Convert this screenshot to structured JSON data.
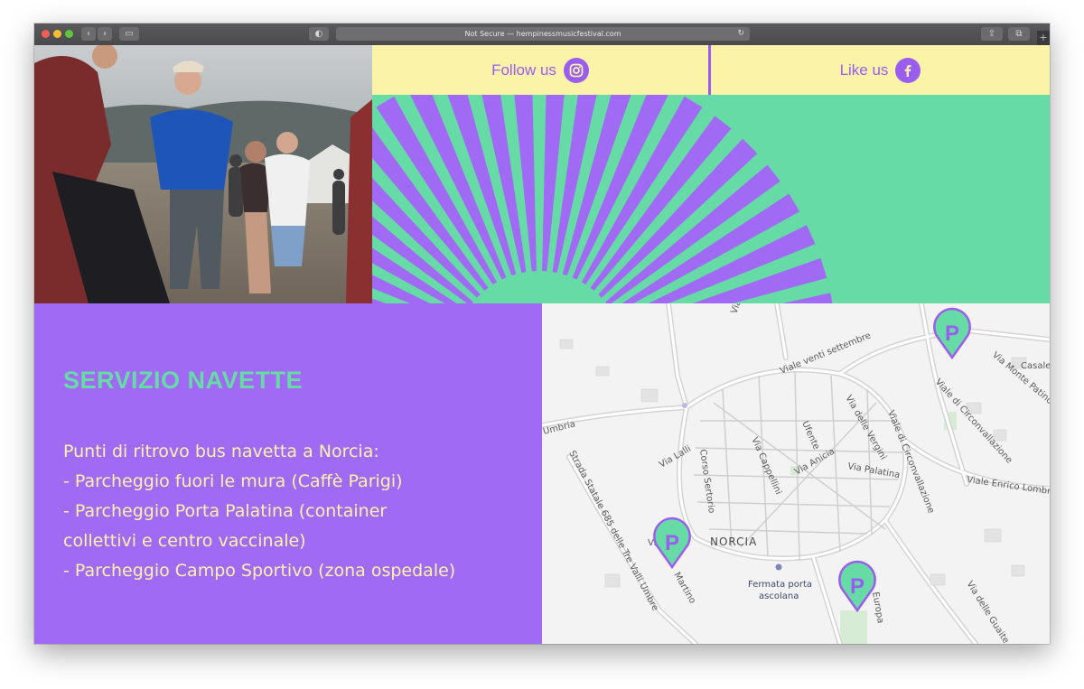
{
  "browser": {
    "url_text": "Not Secure — hempinessmusicfestival.com",
    "new_tab_symbol": "+"
  },
  "social": {
    "follow_label": "Follow us",
    "follow_icon": "instagram-icon",
    "like_label": "Like us",
    "like_icon": "facebook-icon"
  },
  "colors": {
    "purple": "#a06af5",
    "green": "#66dba6",
    "yellow": "#fbf3a8"
  },
  "navette": {
    "title": "SERVIZIO NAVETTE",
    "lines": [
      "Punti di ritrovo bus navetta a Norcia:",
      "- Parcheggio fuori le mura (Caffè Parigi)",
      "- Parcheggio Porta Palatina (container",
      "collettivi e centro vaccinale)",
      "- Parcheggio Campo Sportivo (zona ospedale)"
    ]
  },
  "map": {
    "town": "NORCIA",
    "pin_label": "P",
    "streets": {
      "viale_venti_settembre": "Viale venti settembre",
      "viale_circonvallazione": "Viale di Circonvallazione",
      "via_monte_patino": "Via Monte Patino",
      "casale": "Casale",
      "umbria": "Umbria",
      "via_delle_vergini": "Via delle Vergini",
      "viale_circonvallazione_2": "Viale di Circonvallazione",
      "ufente": "Ufente",
      "via_lalli": "Via Lalli",
      "corso_sertorio": "Corso Sertorio",
      "via_cappellini": "Via Cappellini",
      "via_anicia": "Via Anicia",
      "via_palatina": "Via Palatina",
      "viale_enrico_lombrici": "Viale Enrico Lombri",
      "strada_statale": "Strada Statale 685 delle Tre Valli Umbre",
      "fermata_line1": "Fermata porta",
      "fermata_line2": "ascolana",
      "via_martino": "Martino",
      "europa": "Europa",
      "via_delle_guaite": "Via delle Guaite",
      "via_label_short": "Via",
      "via_top": "Via"
    }
  }
}
